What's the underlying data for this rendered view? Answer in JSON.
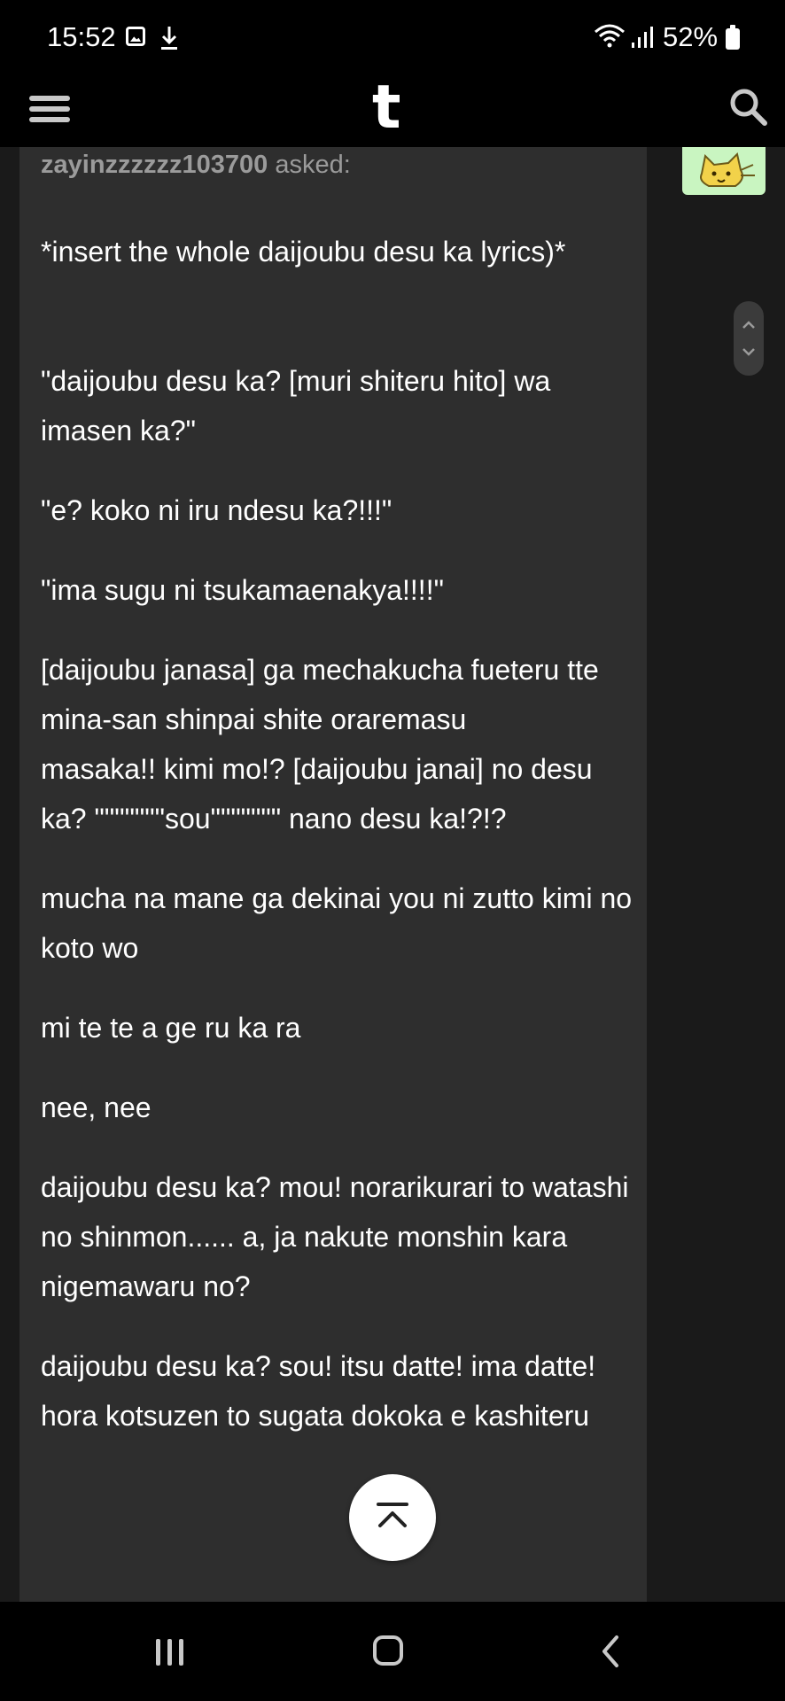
{
  "status_bar": {
    "time": "15:52",
    "battery": "52%",
    "icons": [
      "image-icon",
      "download-icon",
      "wifi-icon",
      "signal-icon",
      "battery-icon"
    ]
  },
  "app_header": {
    "logo": "t",
    "icons": [
      "menu-icon",
      "search-icon"
    ]
  },
  "post": {
    "asker": "zayinzzzzzz103700",
    "asked_label": "asked:",
    "question": "*insert the whole daijoubu desu ka lyrics)*",
    "paragraphs": [
      "\"daijoubu desu ka? [muri shiteru hito] wa imasen ka?\"",
      "\"e? koko ni iru ndesu ka?!!!\"",
      "\"ima sugu ni tsukamaenakya!!!!\"",
      "[daijoubu janasa] ga mechakucha fueteru tte mina-san shinpai shite oraremasu\nmasaka!! kimi mo!? [daijoubu janai] no desu ka? \"\"\"\"\"\"\"sou\"\"\"\"\"\"\" nano desu ka!?!?",
      "mucha na mane ga dekinai you ni zutto kimi no koto wo",
      "mi te te a ge ru ka ra",
      "nee, nee",
      "daijoubu desu ka? mou! norarikurari to watashi no shinmon...... a, ja nakute monshin kara nigemawaru no?",
      "daijoubu desu ka? sou! itsu datte! ima datte!\nhora kotsuzen to sugata dokoka e kashiteru"
    ]
  },
  "colors": {
    "background": "#000000",
    "content_bg": "#1a1a1a",
    "post_bg": "#2e2e2e",
    "text": "#ffffff",
    "muted_text": "#9b9b9b",
    "avatar_bg": "#c9f5c1"
  },
  "controls": {
    "scroll_top_icon": "chevron-up-bar-icon",
    "scroll_pill_icons": [
      "chevron-up-icon",
      "chevron-down-icon"
    ]
  },
  "nav_bar": {
    "icons": [
      "recents-icon",
      "home-icon",
      "back-icon"
    ]
  }
}
